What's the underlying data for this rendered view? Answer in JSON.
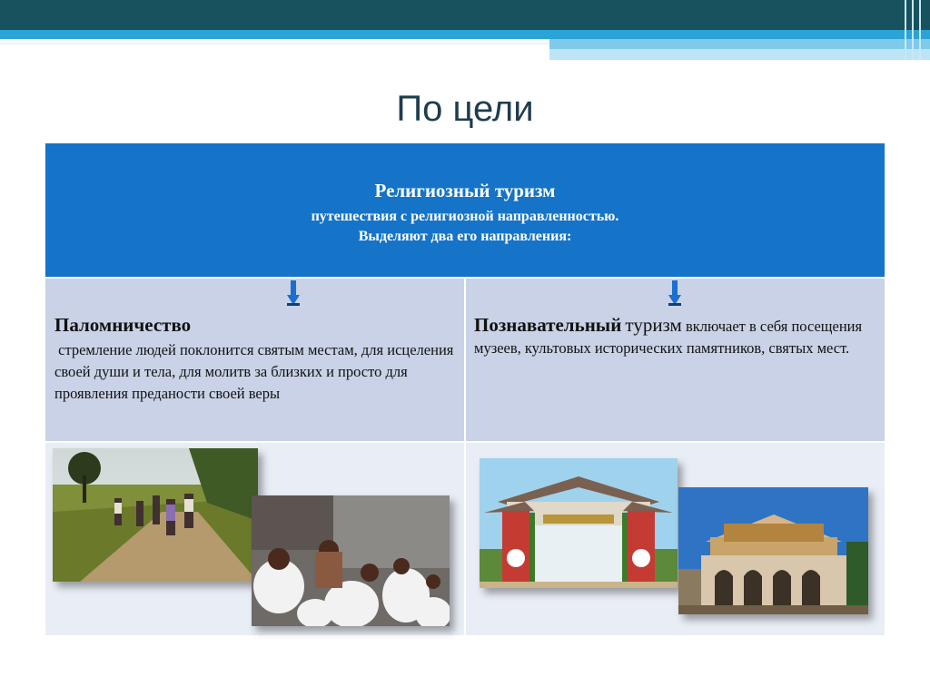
{
  "slide": {
    "title": "По цели"
  },
  "table": {
    "header": {
      "title": "Религиозный туризм",
      "line1": "путешествия с религиозной направленностью.",
      "line2": "Выделяют два его направления:"
    },
    "left": {
      "heading": "Паломничество",
      "body": "стремление людей поклонится святым местам, для исцеления своей души и тела, для молитв за близких и просто для проявления преданости своей веры"
    },
    "right": {
      "heading_bold": "Познавательный",
      "heading_regular": "туризм",
      "body": "включает в себя посещения музеев, культовых исторических памятников, святых мест."
    }
  },
  "colors": {
    "header_fill": "#1573c8",
    "row_fill": "#c9d2e6",
    "row_fill_light": "#e9edf5",
    "arrow": "#1a6fd0",
    "title_text": "#1e3d4e"
  },
  "icons": {
    "down_arrow": "down-arrow-icon"
  }
}
